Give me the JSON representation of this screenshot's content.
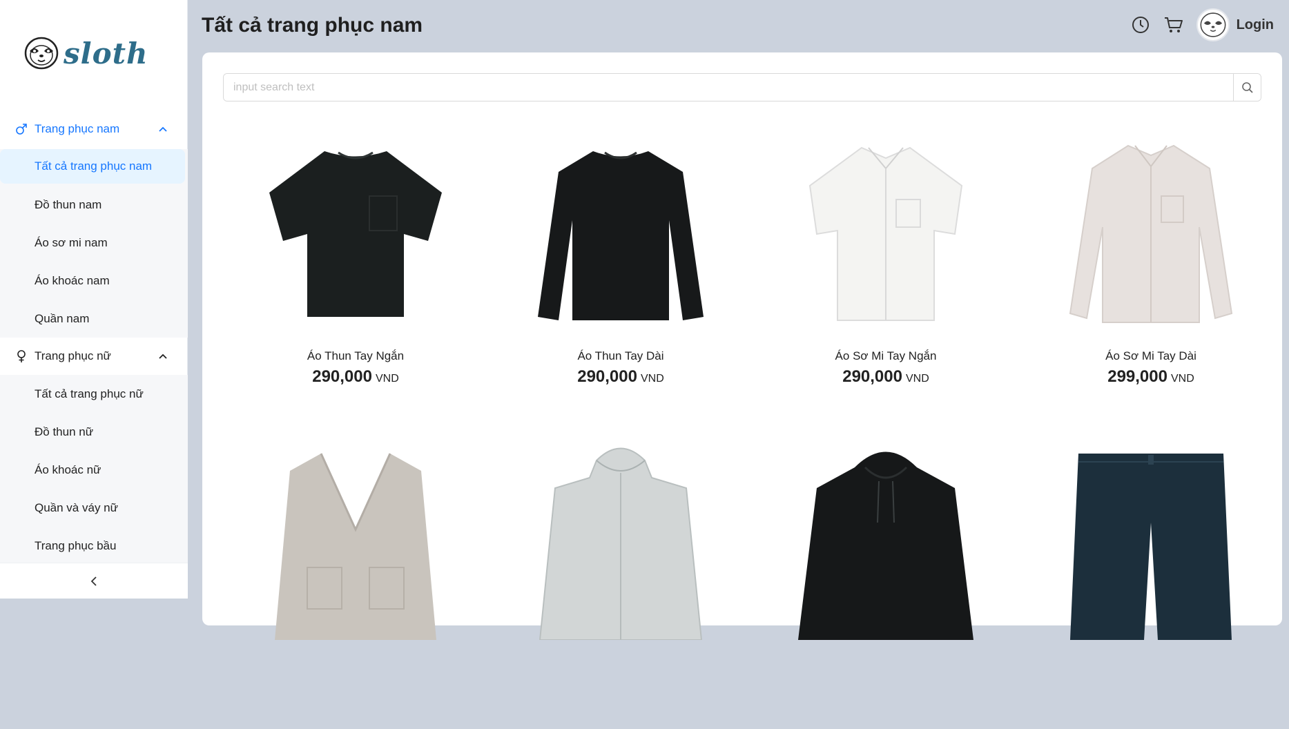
{
  "brand": {
    "name": "sloth"
  },
  "colors": {
    "accent": "#1677ff",
    "logo": "#2e6d8a",
    "background": "#cbd2dd"
  },
  "header": {
    "title": "Tất cả trang phục nam",
    "login_label": "Login",
    "icons": [
      "history-icon",
      "cart-icon",
      "avatar"
    ]
  },
  "sidebar": {
    "groups": [
      {
        "label": "Trang phục nam",
        "icon": "male-icon",
        "expanded": true,
        "items": [
          "Tất cả trang phục nam",
          "Đồ thun nam",
          "Áo sơ mi nam",
          "Áo khoác nam",
          "Quần nam"
        ]
      },
      {
        "label": "Trang phục nữ",
        "icon": "female-icon",
        "expanded": true,
        "items": [
          "Tất cả trang phục nữ",
          "Đồ thun nữ",
          "Áo khoác nữ",
          "Quần và váy nữ",
          "Trang phục bầu"
        ]
      }
    ],
    "selected_item": "Tất cả trang phục nam"
  },
  "search": {
    "placeholder": "input search text",
    "value": ""
  },
  "products": [
    {
      "name": "Áo Thun Tay Ngắn",
      "price": "290,000",
      "currency": "VND",
      "image": "black-short-sleeve-tee"
    },
    {
      "name": "Áo Thun Tay Dài",
      "price": "290,000",
      "currency": "VND",
      "image": "black-long-sleeve-tee"
    },
    {
      "name": "Áo Sơ Mi Tay Ngắn",
      "price": "290,000",
      "currency": "VND",
      "image": "white-short-sleeve-shirt"
    },
    {
      "name": "Áo Sơ Mi Tay Dài",
      "price": "299,000",
      "currency": "VND",
      "image": "beige-long-sleeve-shirt"
    },
    {
      "name": "",
      "price": "",
      "currency": "",
      "image": "beige-cardigan"
    },
    {
      "name": "",
      "price": "",
      "currency": "",
      "image": "light-grey-hooded-jacket"
    },
    {
      "name": "",
      "price": "",
      "currency": "",
      "image": "black-hoodie"
    },
    {
      "name": "",
      "price": "",
      "currency": "",
      "image": "navy-shorts"
    }
  ]
}
